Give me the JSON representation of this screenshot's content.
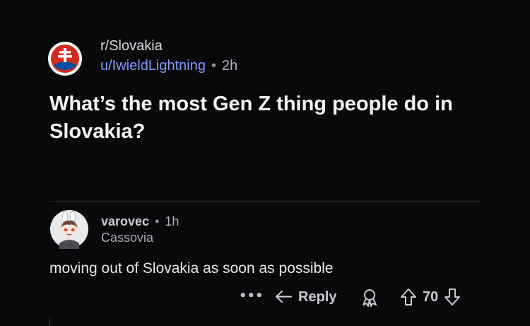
{
  "post": {
    "subreddit": "r/Slovakia",
    "author": "u/IwieldLightning",
    "separator": "•",
    "time": "2h",
    "title": "What’s the most Gen Z thing people do in Slovakia?"
  },
  "comment": {
    "author": "varovec",
    "separator": "•",
    "time": "1h",
    "flair": "Cassovia",
    "body": "moving out of Slovakia as soon as possible",
    "actions": {
      "more_label": "•••",
      "reply_label": "Reply",
      "score": "70"
    }
  },
  "colors": {
    "background": "#09090c",
    "author_link": "#7f9cff",
    "subreddit_icon_red": "#d52b1e",
    "subreddit_icon_blue": "#0b4ea2"
  },
  "icons": [
    "slovakia-coat-of-arms-icon",
    "user-avatar-icon",
    "more-dots-icon",
    "reply-arrow-icon",
    "award-icon",
    "upvote-arrow-icon",
    "downvote-arrow-icon"
  ]
}
